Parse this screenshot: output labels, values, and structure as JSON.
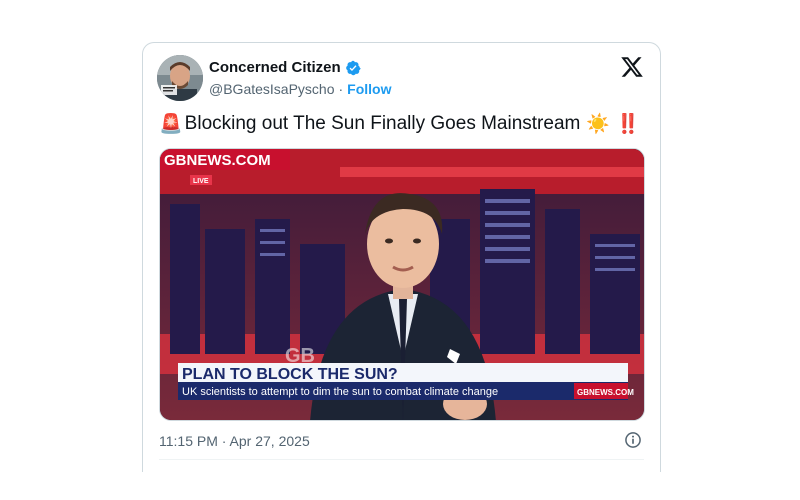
{
  "tweet": {
    "author_name": "Concerned Citizen",
    "handle": "@BGatesIsaPyscho",
    "separator": "·",
    "follow_label": "Follow",
    "text_prefix_emoji": "🚨",
    "text": "Blocking out The Sun Finally Goes Mainstream",
    "text_suffix_emoji_1": "☀️",
    "text_suffix_emoji_2": "‼️",
    "timestamp": "11:15 PM · Apr 27, 2025"
  },
  "video": {
    "channel_logo": "GBNEWS.COM",
    "live_badge": "LIVE",
    "headline": "PLAN TO BLOCK THE SUN?",
    "subheadline": "UK scientists to attempt to dim the sun to combat climate change",
    "ticker_logo": "GBNEWS.COM"
  },
  "icons": {
    "verified": "verified-badge-icon",
    "platform": "x-logo-icon",
    "info": "info-icon"
  },
  "colors": {
    "accent": "#1d9bf0",
    "text_primary": "#0f1419",
    "text_secondary": "#536471",
    "broadcast_red": "#c8102e"
  }
}
